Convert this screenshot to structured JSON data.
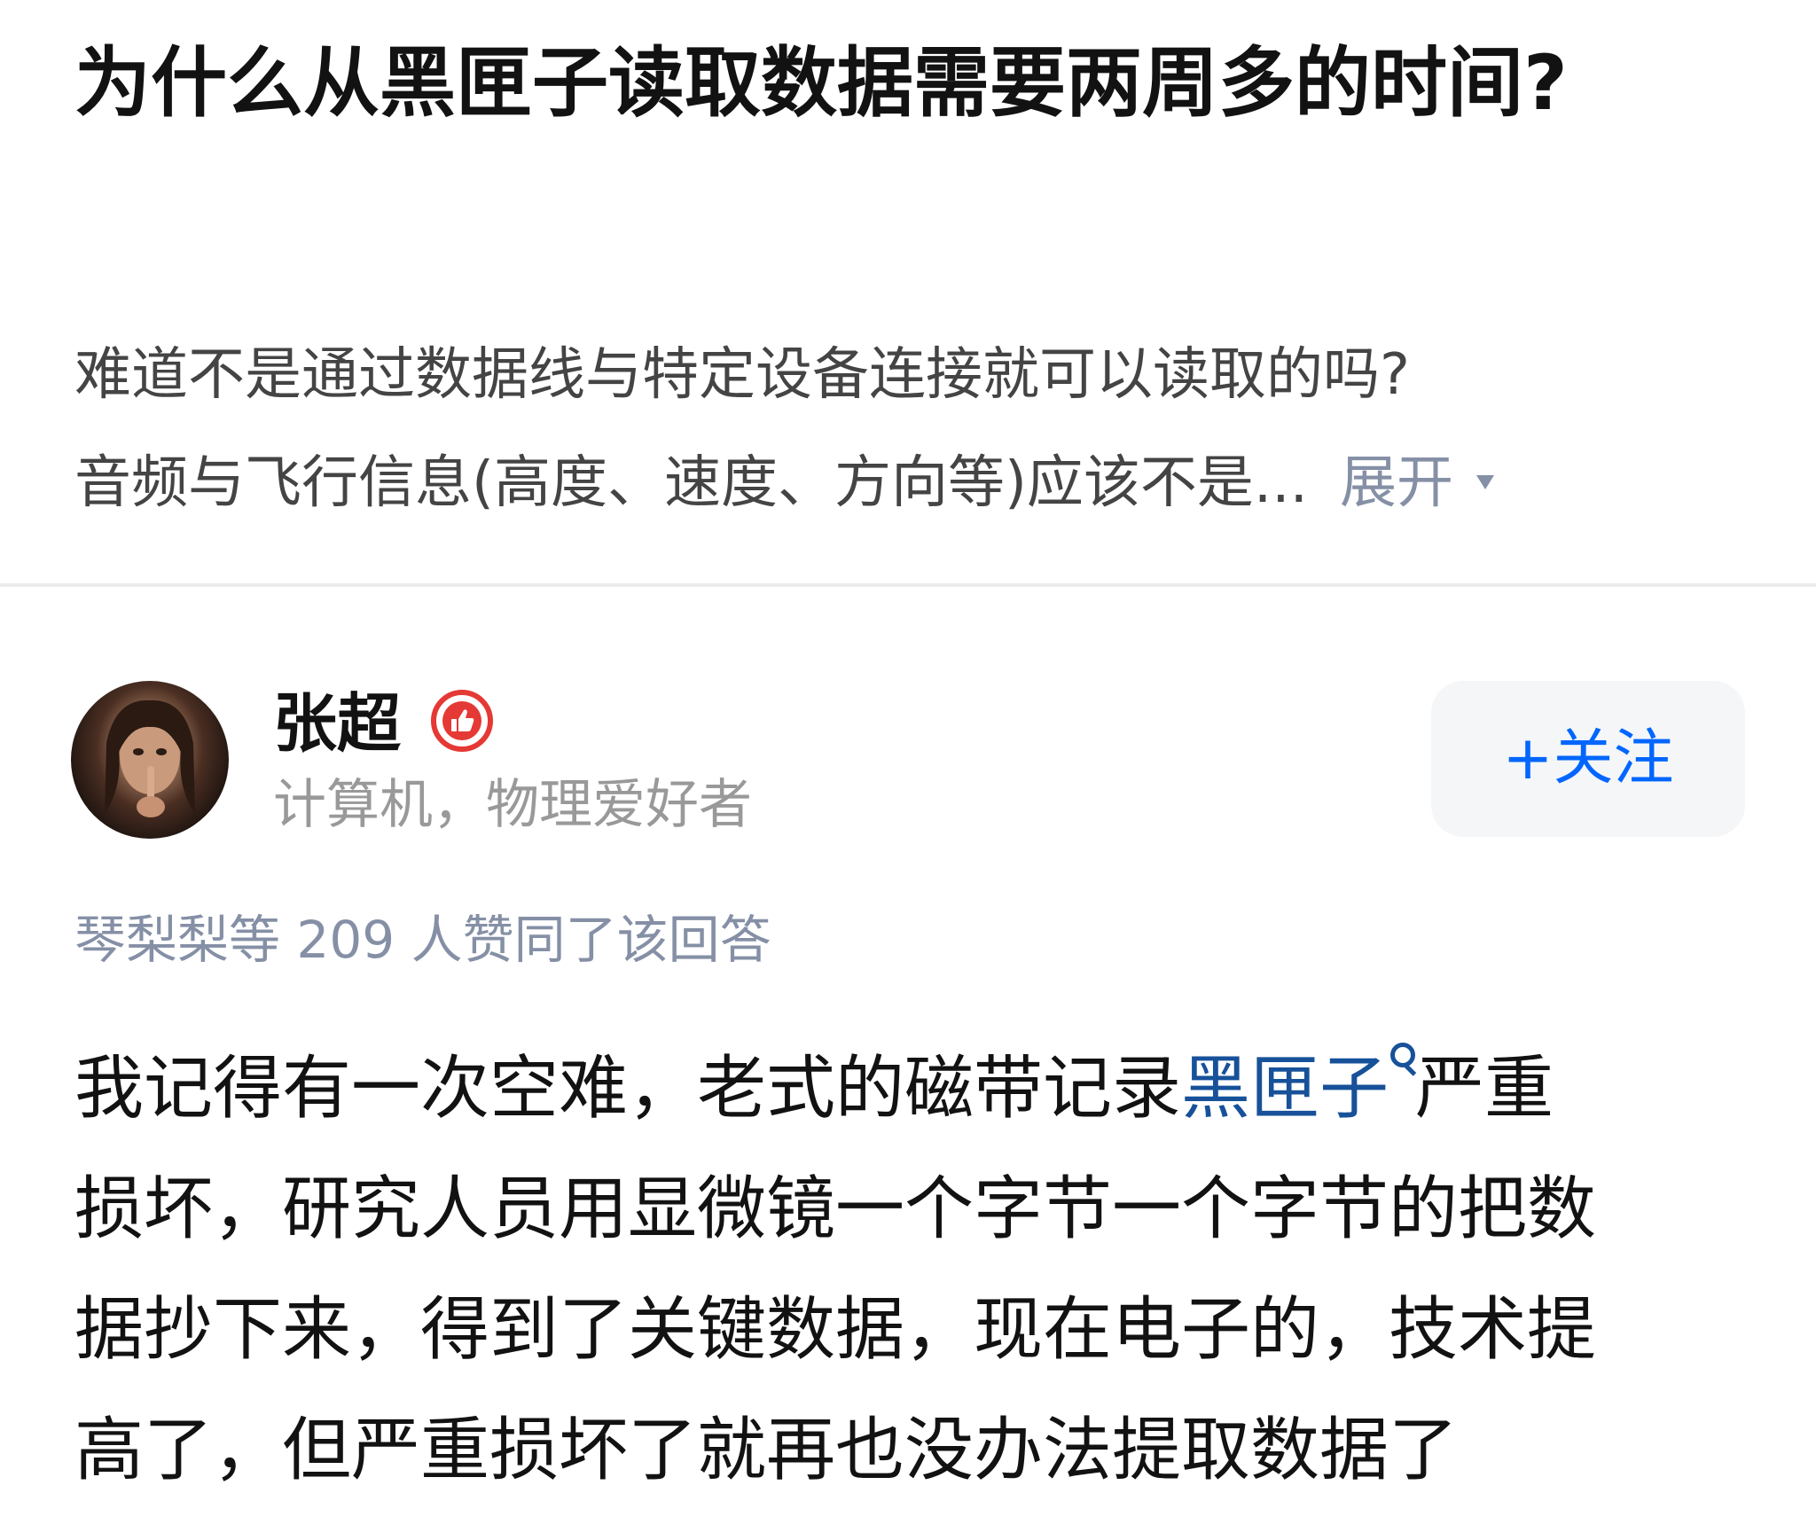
{
  "question": {
    "title": "为什么从黑匣子读取数据需要两周多的时间?",
    "detail_line1": "难道不是通过数据线与特定设备连接就可以读取的吗?",
    "detail_line2": "音频与飞行信息(高度、速度、方向等)应该不是...",
    "expand_label": "展开"
  },
  "author": {
    "name": "张超",
    "bio": "计算机，物理爱好者",
    "follow_label": "+关注",
    "avatar_icon": "avatar-photo",
    "badge_icon": "thumbs-up-icon"
  },
  "vote_info": "琴梨梨等 209 人赞同了该回答",
  "answer": {
    "line1_before": "我记得有一次空难，老式的磁带记录",
    "line1_link": "黑匣子",
    "line1_after": "严重",
    "line2": "损坏，研究人员用显微镜一个字节一个字节的把数",
    "line3": "据抄下来，得到了关键数据，现在电子的，技术提",
    "line4": "高了，但严重损坏了就再也没办法提取数据了"
  },
  "colors": {
    "link": "#175199",
    "follow_text": "#0066ff",
    "meta": "#8590a6",
    "badge": "#e53935"
  }
}
